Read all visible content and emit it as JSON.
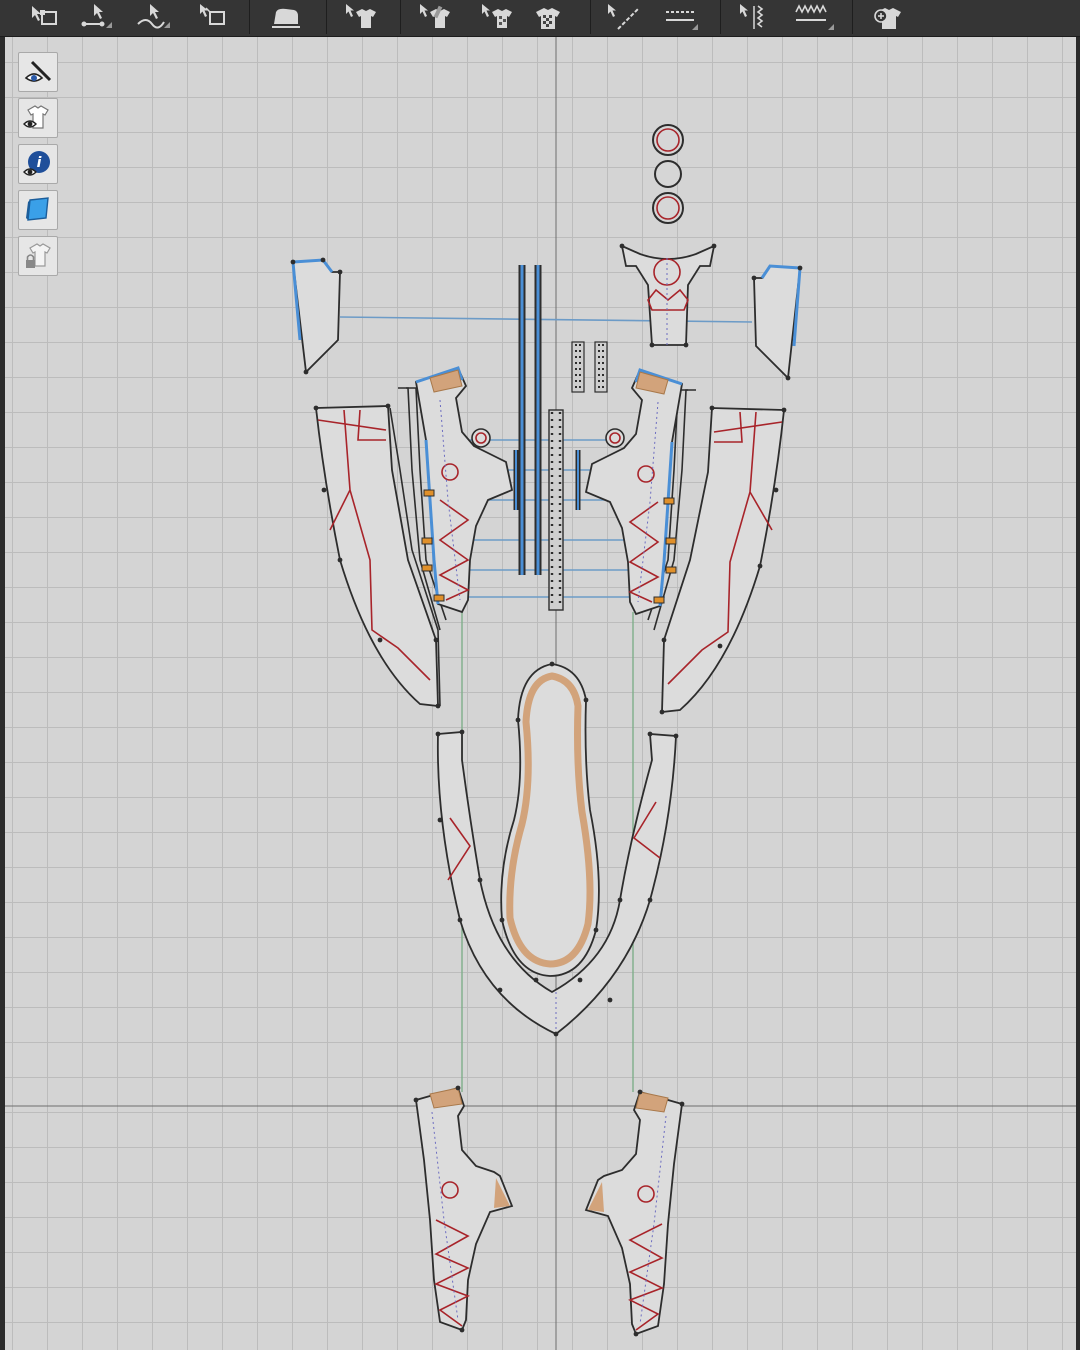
{
  "toolbar": {
    "tools": [
      {
        "name": "edit-pattern-tool-icon"
      },
      {
        "name": "edit-point-tool-icon"
      },
      {
        "name": "edit-curvature-tool-icon"
      },
      {
        "name": "transform-pattern-tool-icon"
      },
      {
        "name": "fold-arrangement-tool-icon"
      },
      {
        "name": "select-garment-tool-icon"
      },
      {
        "name": "edit-texture-tool-icon"
      },
      {
        "name": "edit-uv-tool-icon"
      },
      {
        "name": "checker-grid-tool-icon"
      },
      {
        "name": "internal-line-tool-icon"
      },
      {
        "name": "segment-line-tool-icon"
      },
      {
        "name": "sewing-tool-icon"
      },
      {
        "name": "elastic-sewing-tool-icon"
      },
      {
        "name": "add-pattern-tool-icon"
      }
    ]
  },
  "side_tools": [
    {
      "name": "show-pattern-outline-icon"
    },
    {
      "name": "show-garment-icon"
    },
    {
      "name": "show-pattern-info-icon"
    },
    {
      "name": "show-fabric-texture-icon"
    },
    {
      "name": "lock-garment-icon"
    }
  ],
  "colors": {
    "toolbar_bg": "#353535",
    "workspace_bg": "#d4d4d4",
    "grid_line": "#bcbcbc",
    "pattern_fill": "#dcdcdc",
    "pattern_outline": "#2d2d2d",
    "selected_outline": "#4a8fd6",
    "internal_line": "#a8242a",
    "seam_allowance": "#d2a37b",
    "sewing_line": "#6c9bc7",
    "symmetry_line": "#7fae8a"
  }
}
